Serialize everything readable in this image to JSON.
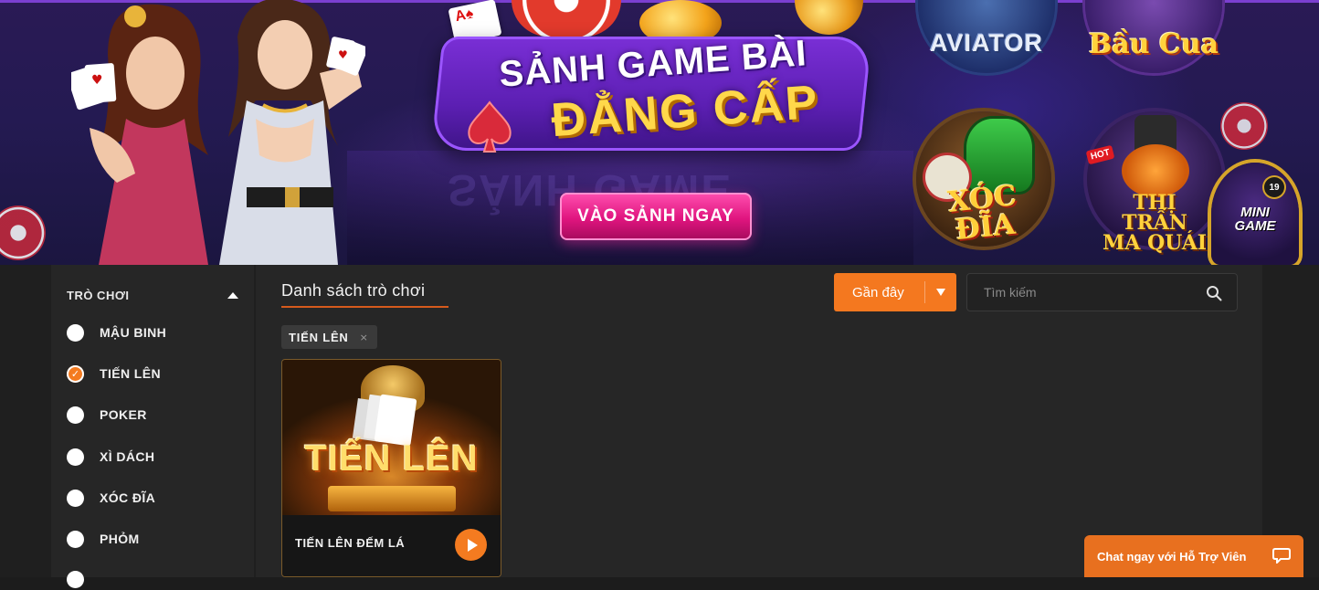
{
  "banner": {
    "title_line1": "SẢNH GAME BÀI",
    "title_line2": "ĐẲNG CẤP",
    "mirror_text": "SẢNH GAME",
    "cta_label": "VÀO SẢNH NGAY",
    "games": [
      {
        "label": "AVIATOR"
      },
      {
        "label": "Bầu Cua"
      },
      {
        "label": "XÓC ĐĨA"
      },
      {
        "label": "THỊ TRẤN MA QUÁI",
        "badge": "HOT"
      },
      {
        "label": "MINI GAME",
        "age": "19"
      }
    ]
  },
  "sidebar": {
    "heading": "TRÒ CHƠI",
    "items": [
      {
        "label": "MẬU BINH",
        "checked": false
      },
      {
        "label": "TIẾN LÊN",
        "checked": true
      },
      {
        "label": "POKER",
        "checked": false
      },
      {
        "label": "XÌ DÁCH",
        "checked": false
      },
      {
        "label": "XÓC ĐĨA",
        "checked": false
      },
      {
        "label": "PHỎM",
        "checked": false
      }
    ]
  },
  "content": {
    "title": "Danh sách trò chơi",
    "sort_label": "Gần đây",
    "search_placeholder": "Tìm kiếm",
    "filter_chip": "TIẾN LÊN",
    "chip_close": "×",
    "cards": [
      {
        "art_title": "TIẾN LÊN",
        "name": "TIẾN LÊN ĐẾM LÁ"
      }
    ]
  },
  "chat": {
    "label": "Chat ngay với Hỗ Trợ Viên"
  },
  "colors": {
    "accent": "#f4781f",
    "cta_pink": "#e0157f",
    "panel": "#262626"
  }
}
